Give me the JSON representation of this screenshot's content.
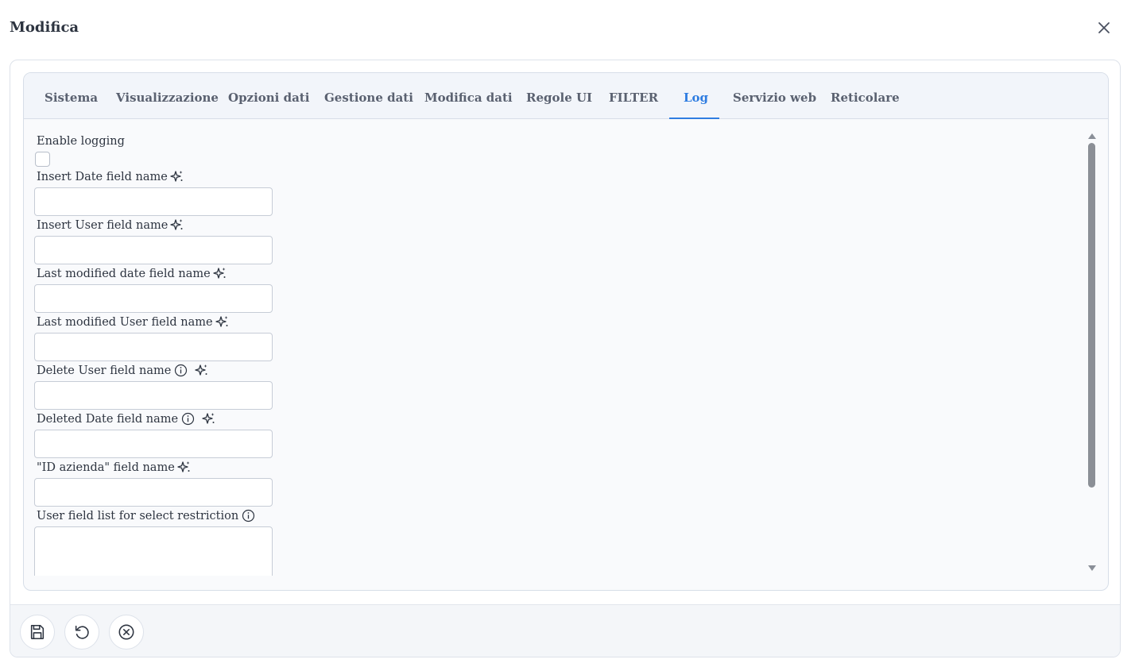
{
  "dialog": {
    "title": "Modifica"
  },
  "tabs": [
    {
      "label": "Sistema"
    },
    {
      "label": "Visualizzazione"
    },
    {
      "label": "Opzioni dati"
    },
    {
      "label": "Gestione dati"
    },
    {
      "label": "Modifica dati"
    },
    {
      "label": "Regole UI"
    },
    {
      "label": "FILTER"
    },
    {
      "label": "Log",
      "active": true
    },
    {
      "label": "Servizio web"
    },
    {
      "label": "Reticolare"
    }
  ],
  "form": {
    "enable_logging": {
      "label": "Enable logging",
      "checked": false
    },
    "insert_date": {
      "label": "Insert Date field name",
      "value": ""
    },
    "insert_user": {
      "label": "Insert User field name",
      "value": ""
    },
    "last_modified_date": {
      "label": "Last modified date field name",
      "value": ""
    },
    "last_modified_user": {
      "label": "Last modified User field name",
      "value": ""
    },
    "delete_user": {
      "label": "Delete User field name",
      "value": ""
    },
    "deleted_date": {
      "label": "Deleted Date field name",
      "value": ""
    },
    "id_azienda": {
      "label": "\"ID azienda\" field name",
      "value": ""
    },
    "user_field_list": {
      "label": "User field list for select restriction",
      "value": ""
    }
  },
  "icons": {
    "close": "close-icon",
    "sparkle": "sparkle-icon",
    "info": "info-icon",
    "save": "save-icon",
    "undo": "undo-icon",
    "cancel": "cancel-icon"
  },
  "colors": {
    "accent": "#2f7de1",
    "text": "#2d3440",
    "tab_text": "#5a6170"
  }
}
